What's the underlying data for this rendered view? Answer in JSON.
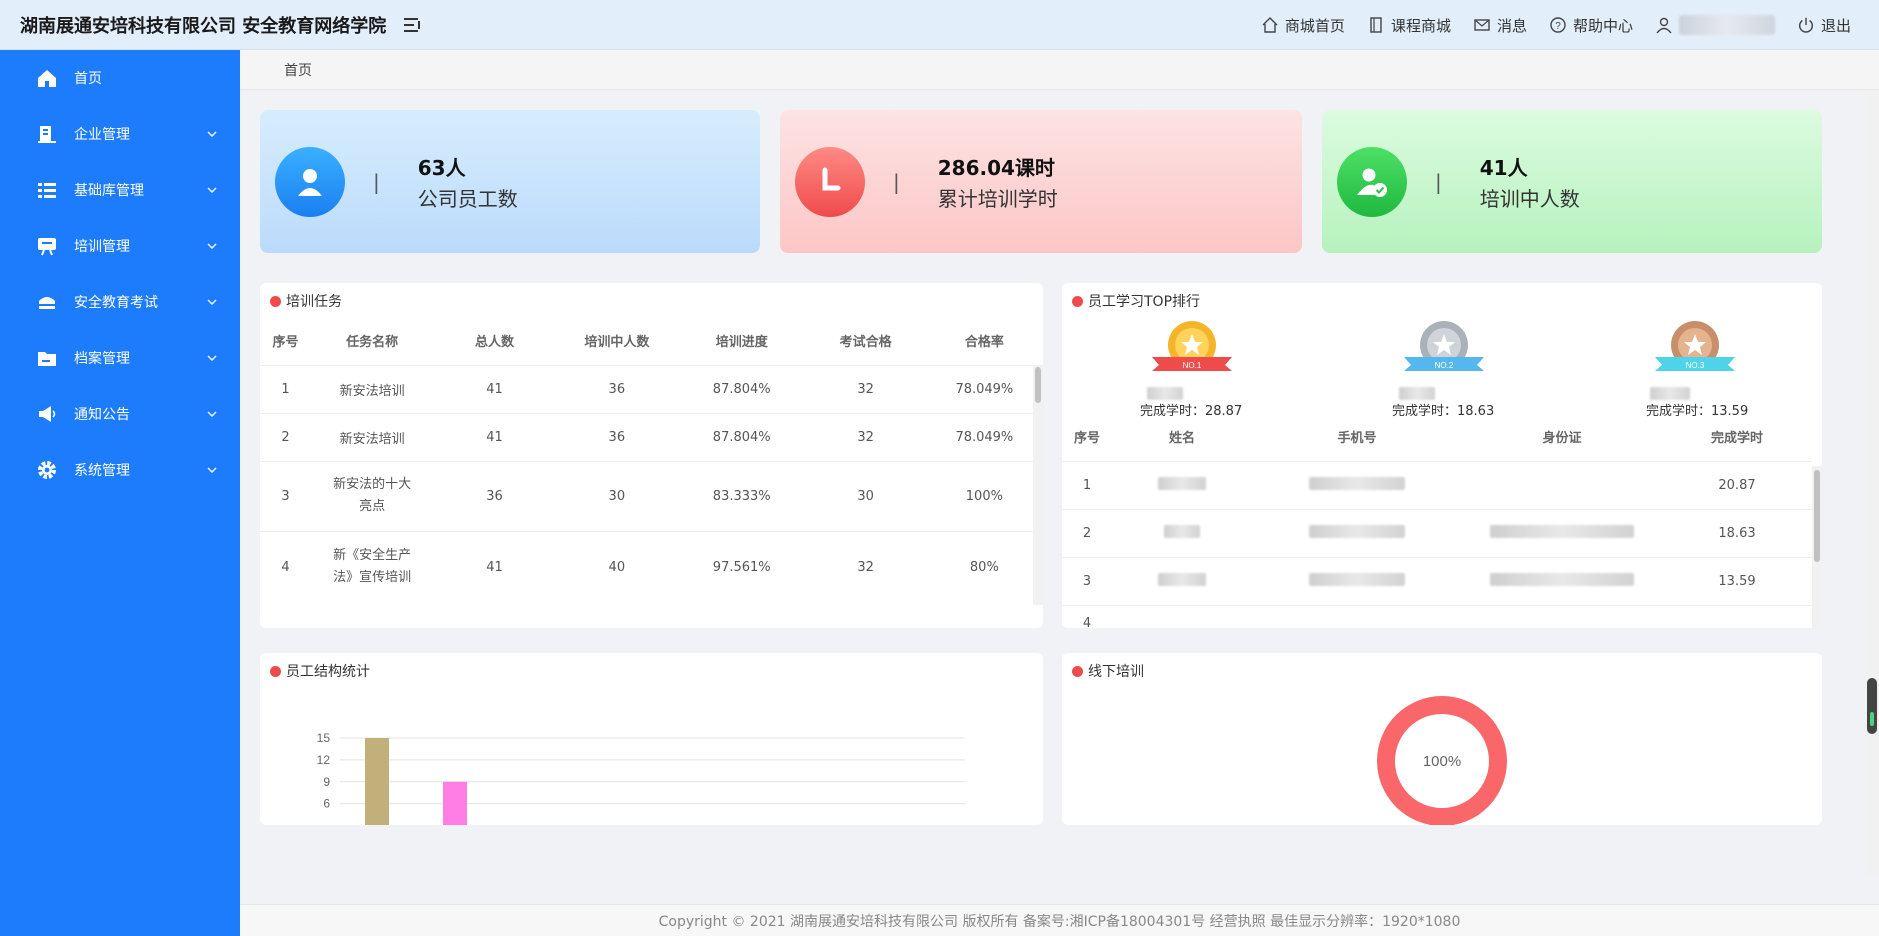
{
  "header": {
    "brand": "湖南展通安培科技有限公司 安全教育网络学院",
    "nav": [
      {
        "label": "商城首页",
        "icon": "home-icon"
      },
      {
        "label": "课程商城",
        "icon": "book-icon"
      },
      {
        "label": "消息",
        "icon": "mail-icon"
      },
      {
        "label": "帮助中心",
        "icon": "help-icon"
      }
    ],
    "logout": "退出"
  },
  "sidebar": {
    "items": [
      {
        "label": "首页",
        "icon": "home-icon"
      },
      {
        "label": "企业管理",
        "icon": "building-icon"
      },
      {
        "label": "基础库管理",
        "icon": "list-icon"
      },
      {
        "label": "培训管理",
        "icon": "monitor-icon"
      },
      {
        "label": "安全教育考试",
        "icon": "cap-icon"
      },
      {
        "label": "档案管理",
        "icon": "folder-icon"
      },
      {
        "label": "通知公告",
        "icon": "megaphone-icon"
      },
      {
        "label": "系统管理",
        "icon": "gear-icon"
      }
    ]
  },
  "breadcrumb": "首页",
  "stats": [
    {
      "value": "63人",
      "label": "公司员工数"
    },
    {
      "value": "286.04课时",
      "label": "累计培训学时"
    },
    {
      "value": "41人",
      "label": "培训中人数"
    }
  ],
  "training_tasks": {
    "title": "培训任务",
    "columns": [
      "序号",
      "任务名称",
      "总人数",
      "培训中人数",
      "培训进度",
      "考试合格",
      "合格率"
    ],
    "rows": [
      [
        "1",
        "新安法培训",
        "41",
        "36",
        "87.804%",
        "32",
        "78.049%"
      ],
      [
        "2",
        "新安法培训",
        "41",
        "36",
        "87.804%",
        "32",
        "78.049%"
      ],
      [
        "3",
        "新安法的十大亮点",
        "36",
        "30",
        "83.333%",
        "30",
        "100%"
      ],
      [
        "4",
        "新《安全生产法》宣传培训",
        "41",
        "40",
        "97.561%",
        "32",
        "80%"
      ]
    ]
  },
  "ranking": {
    "title": "员工学习TOP排行",
    "podium": [
      {
        "badge": "NO.1",
        "hours": "完成学时：28.87",
        "color": "#f5b52a"
      },
      {
        "badge": "NO.2",
        "hours": "完成学时：18.63",
        "color": "#b9bfc6"
      },
      {
        "badge": "NO.3",
        "hours": "完成学时：13.59",
        "color": "#d9a27e"
      }
    ],
    "columns": [
      "序号",
      "姓名",
      "手机号",
      "身份证",
      "完成学时"
    ],
    "rows": [
      [
        "1",
        "20.87"
      ],
      [
        "2",
        "18.63"
      ],
      [
        "3",
        "13.59"
      ],
      [
        "4",
        ""
      ]
    ]
  },
  "structure": {
    "title": "员工结构统计"
  },
  "offline": {
    "title": "线下培训",
    "percent": "100%",
    "color": "#f9676b"
  },
  "chart_data": {
    "type": "bar",
    "ylim": [
      0,
      15
    ],
    "yticks": [
      "15",
      "12",
      "9",
      "6"
    ],
    "values": [
      15,
      9
    ],
    "colors": [
      "#c2b07a",
      "#ff7ee6"
    ]
  },
  "footer": "Copyright © 2021 湖南展通安培科技有限公司 版权所有 备案号:湘ICP备18004301号 经营执照 最佳显示分辨率：1920*1080"
}
